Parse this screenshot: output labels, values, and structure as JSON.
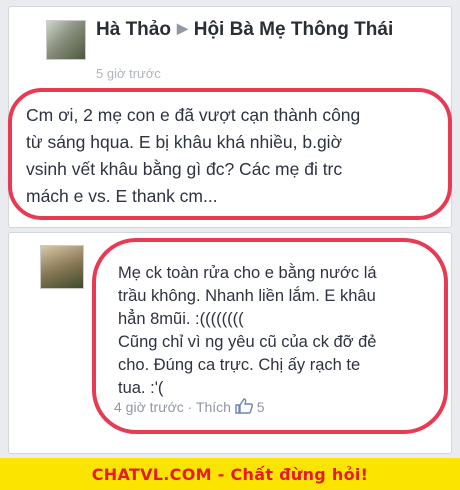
{
  "post": {
    "author": "Hà Thảo",
    "group": "Hội Bà Mẹ Thông Thái",
    "time": "5 giờ trước",
    "body_lines": [
      "Cm ơi, 2 mẹ con e đã vượt cạn thành công",
      "từ sáng hqua. E bị khâu khá nhiều, b.giờ",
      "vsinh vết khâu bằng gì đc? Các mẹ đi trc",
      "mách e vs. E thank cm..."
    ]
  },
  "comment": {
    "body_lines": [
      "Mẹ ck toàn rửa cho e bằng nước lá",
      "trầu không. Nhanh liền lắm. E khâu",
      "hẳn 8mũi. :((((((((",
      "Cũng chỉ vì ng yêu cũ của ck đỡ đẻ",
      "cho. Đúng ca trực. Chị ấy rạch te",
      "tua. :'("
    ],
    "time": "4 giờ trước",
    "separator": "·",
    "like_label": "Thích",
    "like_count": "5"
  },
  "banner": {
    "text": "CHATVL.COM - Chất đừng hỏi!",
    "bg_color": "#fbe400",
    "text_color": "#e8192c"
  },
  "accent": {
    "circle_color": "#e83a52"
  }
}
